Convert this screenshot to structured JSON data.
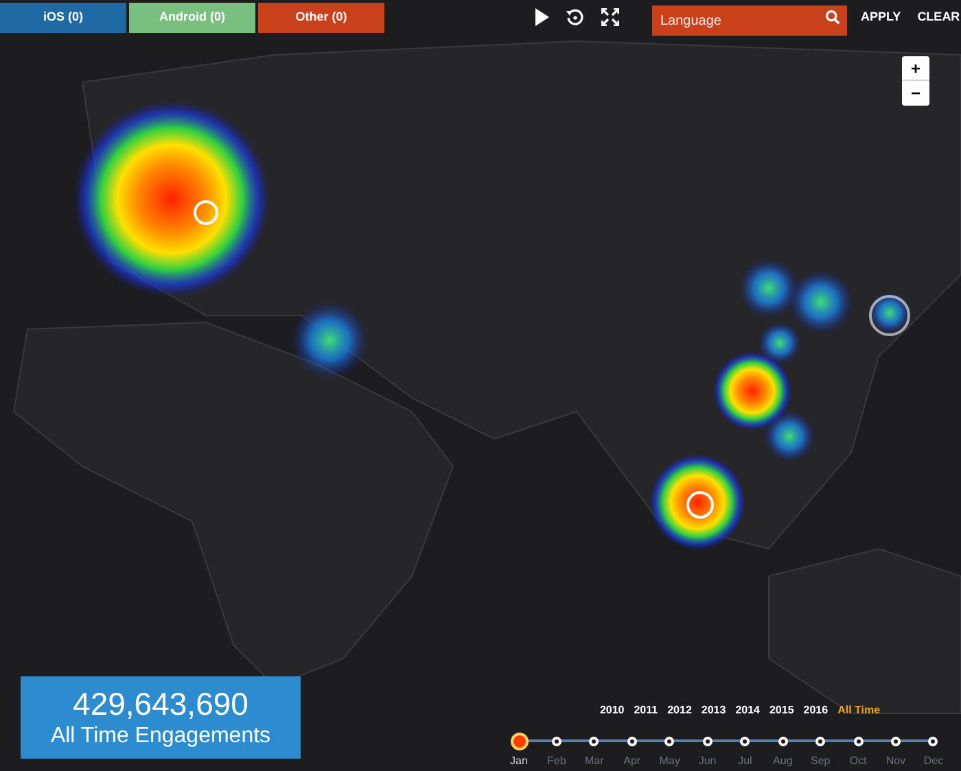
{
  "filters": [
    {
      "label": "iOS (0)",
      "color": "#1f6aa5"
    },
    {
      "label": "Android (0)",
      "color": "#78bf80"
    },
    {
      "label": "Other (0)",
      "color": "#c9401a"
    }
  ],
  "language": {
    "placeholder": "Language"
  },
  "actions": [
    "APPLY",
    "CLEAR"
  ],
  "zoom": [
    "+",
    "−"
  ],
  "stats": {
    "value": "429,643,690",
    "label": "All Time Engagements"
  },
  "years": [
    {
      "label": "2010",
      "selected": false
    },
    {
      "label": "2011",
      "selected": false
    },
    {
      "label": "2012",
      "selected": false
    },
    {
      "label": "2013",
      "selected": false
    },
    {
      "label": "2014",
      "selected": false
    },
    {
      "label": "2015",
      "selected": false
    },
    {
      "label": "2016",
      "selected": false
    },
    {
      "label": "All Time",
      "selected": true
    }
  ],
  "months": [
    {
      "label": "Jan",
      "selected": true
    },
    {
      "label": "Feb",
      "selected": false
    },
    {
      "label": "Mar",
      "selected": false
    },
    {
      "label": "Apr",
      "selected": false
    },
    {
      "label": "May",
      "selected": false
    },
    {
      "label": "Jun",
      "selected": false
    },
    {
      "label": "Jul",
      "selected": false
    },
    {
      "label": "Aug",
      "selected": false
    },
    {
      "label": "Sep",
      "selected": false
    },
    {
      "label": "Oct",
      "selected": false
    },
    {
      "label": "Nov",
      "selected": false
    },
    {
      "label": "Dec",
      "selected": false
    }
  ]
}
